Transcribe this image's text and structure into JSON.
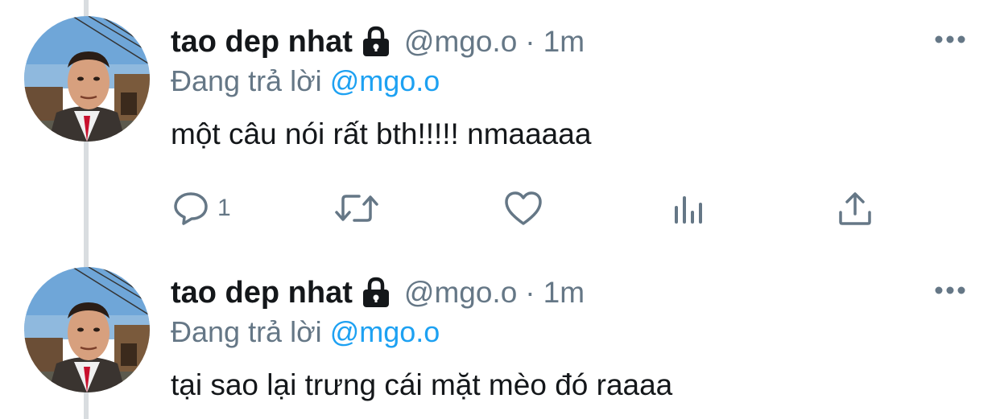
{
  "tweets": [
    {
      "display_name": "tao dep nhat",
      "handle": "@mgo.o",
      "separator": "·",
      "time": "1m",
      "reply_prefix": "Đang trả lời",
      "reply_to": "@mgo.o",
      "text": "một câu nói rất bth!!!!! nmaaaaa",
      "reply_count": "1",
      "icons": [
        "lock-icon",
        "more-icon",
        "reply-icon",
        "retweet-icon",
        "like-icon",
        "analytics-icon",
        "share-icon"
      ]
    },
    {
      "display_name": "tao dep nhat",
      "handle": "@mgo.o",
      "separator": "·",
      "time": "1m",
      "reply_prefix": "Đang trả lời",
      "reply_to": "@mgo.o",
      "text": "tại sao lại trưng cái mặt mèo đó raaaa",
      "icons": [
        "lock-icon",
        "more-icon"
      ]
    }
  ],
  "colors": {
    "text": "#14171a",
    "secondary": "#657786",
    "link": "#1da1f2",
    "thread_line": "#d9dde0"
  }
}
